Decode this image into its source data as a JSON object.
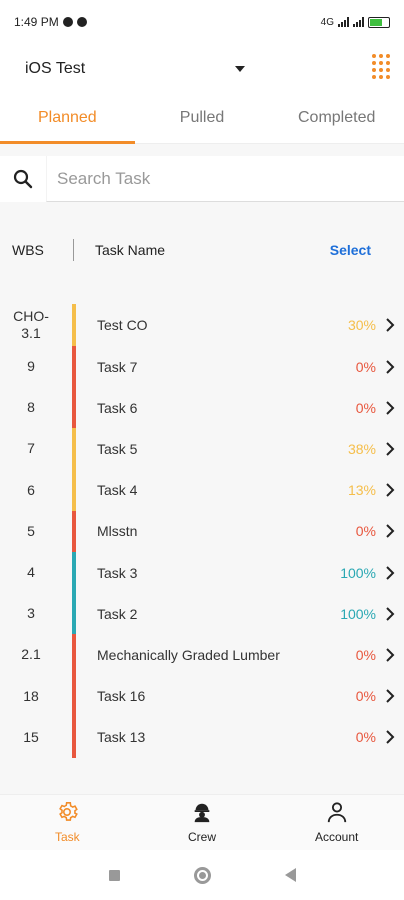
{
  "status": {
    "time": "1:49 PM",
    "network": "4G"
  },
  "header": {
    "project": "iOS Test",
    "menu_icon": "grid-dots-icon"
  },
  "tabs": [
    {
      "label": "Planned",
      "active": true
    },
    {
      "label": "Pulled",
      "active": false
    },
    {
      "label": "Completed",
      "active": false
    }
  ],
  "search": {
    "placeholder": "Search Task",
    "value": ""
  },
  "columns": {
    "wbs": "WBS",
    "task_name": "Task Name",
    "select": "Select"
  },
  "colors": {
    "accent": "#f28c28",
    "link": "#1e6fd9",
    "yellow": "#f5be4a",
    "red": "#e8573e",
    "teal": "#2aa8b3"
  },
  "tasks": [
    {
      "wbs": "CHO-\n3.1",
      "name": "Test CO",
      "pct": "30%",
      "color": "#f5be4a"
    },
    {
      "wbs": "9",
      "name": "Task 7",
      "pct": "0%",
      "color": "#e8573e"
    },
    {
      "wbs": "8",
      "name": "Task 6",
      "pct": "0%",
      "color": "#e8573e"
    },
    {
      "wbs": "7",
      "name": "Task 5",
      "pct": "38%",
      "color": "#f5be4a"
    },
    {
      "wbs": "6",
      "name": "Task 4",
      "pct": "13%",
      "color": "#f5be4a"
    },
    {
      "wbs": "5",
      "name": "Mlsstn",
      "pct": "0%",
      "color": "#e8573e"
    },
    {
      "wbs": "4",
      "name": "Task 3",
      "pct": "100%",
      "color": "#2aa8b3"
    },
    {
      "wbs": "3",
      "name": "Task 2",
      "pct": "100%",
      "color": "#2aa8b3"
    },
    {
      "wbs": "2.1",
      "name": "Mechanically Graded Lumber",
      "pct": "0%",
      "color": "#e8573e"
    },
    {
      "wbs": "18",
      "name": "Task 16",
      "pct": "0%",
      "color": "#e8573e"
    },
    {
      "wbs": "15",
      "name": "Task 13",
      "pct": "0%",
      "color": "#e8573e"
    }
  ],
  "bottom_nav": [
    {
      "label": "Task",
      "icon": "gear-icon",
      "active": true
    },
    {
      "label": "Crew",
      "icon": "crew-icon",
      "active": false
    },
    {
      "label": "Account",
      "icon": "person-icon",
      "active": false
    }
  ]
}
